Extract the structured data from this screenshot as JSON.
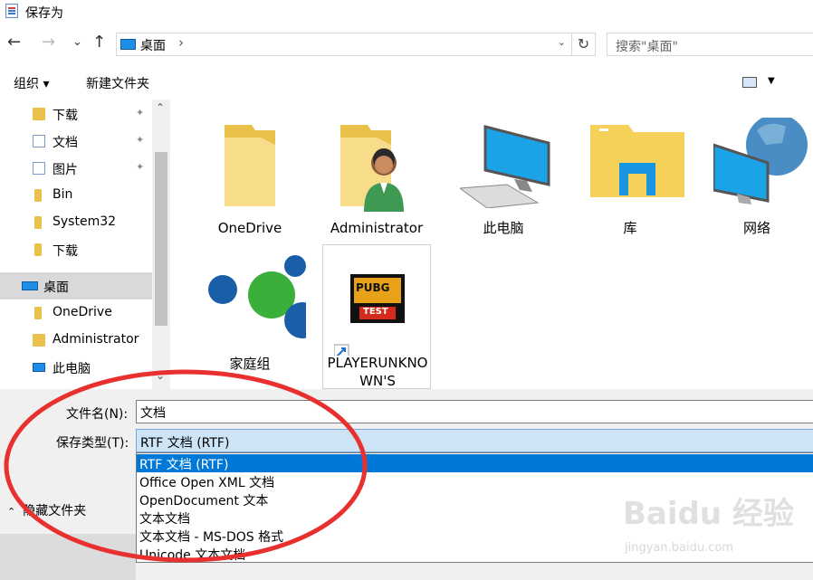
{
  "window": {
    "title": "保存为"
  },
  "nav": {
    "back": "←",
    "forward": "→",
    "recent": "⌄",
    "up": "↑"
  },
  "address": {
    "crumb": "桌面",
    "separator": "›"
  },
  "search": {
    "placeholder": "搜索\"桌面\""
  },
  "toolbar": {
    "organize": "组织 ▾",
    "new_folder": "新建文件夹"
  },
  "sidebar": {
    "items": [
      {
        "label": "下载",
        "pinned": true
      },
      {
        "label": "文档",
        "pinned": true
      },
      {
        "label": "图片",
        "pinned": true
      },
      {
        "label": "Bin"
      },
      {
        "label": "System32"
      },
      {
        "label": "下载"
      },
      {
        "label": "桌面",
        "selected": true
      },
      {
        "label": "OneDrive"
      },
      {
        "label": "Administrator"
      },
      {
        "label": "此电脑"
      }
    ],
    "pin_glyph": "📌"
  },
  "content": {
    "items": [
      {
        "label": "OneDrive",
        "icon": "folder-icon"
      },
      {
        "label": "Administrator",
        "icon": "user-folder-icon"
      },
      {
        "label": "此电脑",
        "icon": "computer-icon"
      },
      {
        "label": "库",
        "icon": "library-icon"
      },
      {
        "label": "网络",
        "icon": "network-icon"
      },
      {
        "label": "家庭组",
        "icon": "homegroup-icon"
      },
      {
        "label": "PLAYERUNKNO",
        "label2": "WN'S",
        "icon": "pubg-shortcut-icon",
        "badge": "PUBG",
        "badge2": "TEST"
      }
    ]
  },
  "form": {
    "filename_label": "文件名(N):",
    "filename_value": "文档",
    "filetype_label": "保存类型(T):",
    "filetype_value": "RTF 文档 (RTF)",
    "filetype_options": [
      "RTF 文档 (RTF)",
      "Office Open XML 文档",
      "OpenDocument 文本",
      "文本文档",
      "文本文档 - MS-DOS 格式",
      "Unicode 文本文档"
    ]
  },
  "hide_folders": {
    "arrow": "⌃",
    "label": "隐藏文件夹"
  },
  "watermark": {
    "line1": "Baidu 经验",
    "line2": "jingyan.baidu.com"
  },
  "colors": {
    "accent": "#0078d7",
    "annotation": "#e8302f"
  }
}
